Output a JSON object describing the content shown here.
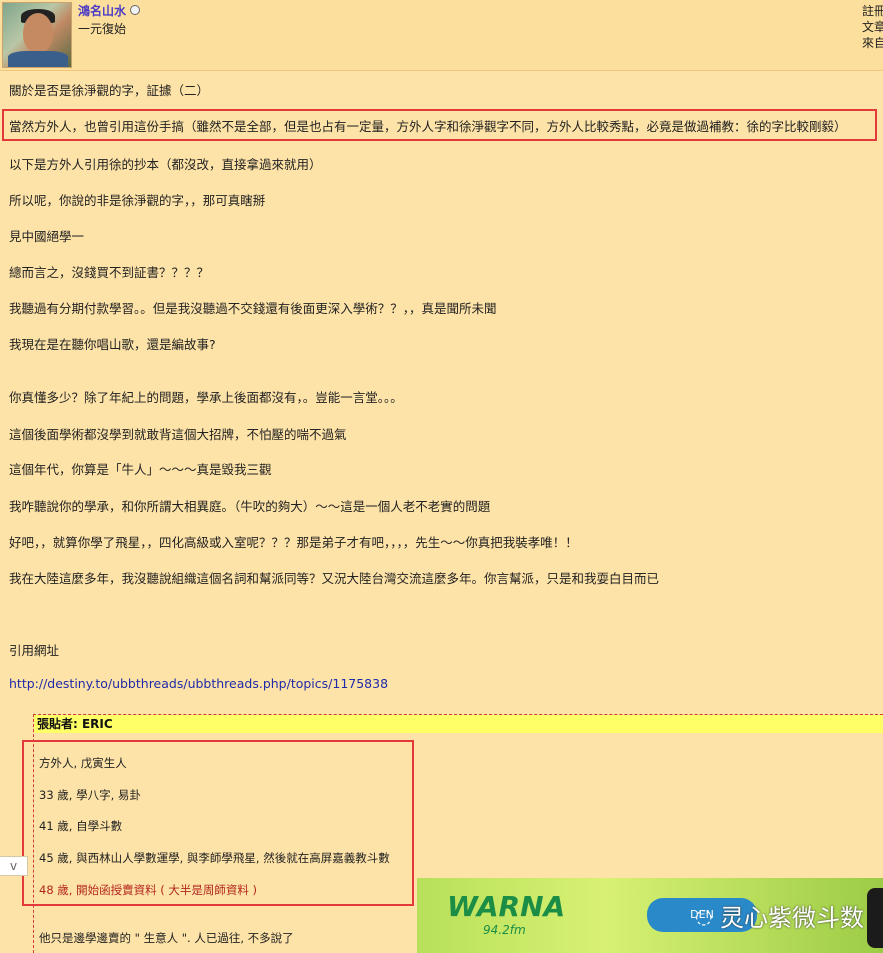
{
  "post": {
    "username": "鴻名山水",
    "user_title": "一元復始",
    "meta": [
      "註冊",
      "文章",
      "來自"
    ],
    "lines": [
      "關於是否是徐淨觀的字，証據（二）",
      "當然方外人，也曾引用這份手搞（雖然不是全部，但是也占有一定量，方外人字和徐淨觀字不同，方外人比較秀點，必竟是做過補教：徐的字比較剛毅）",
      "以下是方外人引用徐的抄本（都沒改，直接拿過來就用）",
      "所以呢，你說的非是徐淨觀的字，，那可真瞎掰",
      "見中國絕學一",
      "總而言之，沒錢買不到証書？？？？",
      "我聽過有分期付款學習。。但是我沒聽過不交錢還有後面更深入學術？？，，真是聞所未聞",
      "我現在是在聽你唱山歌，還是編故事?",
      "你真懂多少？除了年紀上的問題，學承上後面都沒有，。豈能一言堂。。。",
      "這個後面學術都沒學到就敢背這個大招牌，不怕壓的喘不過氣",
      "這個年代，你算是「牛人」～～～真是毀我三觀",
      "我咋聽說你的學承，和你所謂大相異庭。（牛吹的夠大）～～這是一個人老不老實的問題",
      "好吧，，就算你學了飛星，，四化高級或入室呢？？？那是弟子才有吧，，，，先生～～你真把我裝孝唯！！",
      "我在大陸這麼多年，我沒聽說組織這個名詞和幫派同等？又況大陸台灣交流這麼多年。你言幫派，只是和我耍白目而已",
      "引用網址"
    ],
    "link": "http://destiny.to/ubbthreads/ubbthreads.php/topics/1175838"
  },
  "quote": {
    "header": "張貼者: ERIC",
    "lines": [
      "方外人, 戊寅生人",
      "33 歲, 學八字, 易卦",
      "41 歲, 自學斗數",
      "45 歲, 與西林山人學數運學, 與李師學飛星, 然後就在高屏嘉義教斗數",
      "48 歲, 開始函授賣資料 ( 大半是周師資料 )",
      "他只是邊學邊賣的 \" 生意人 \". 人已過往, 不多說了"
    ]
  },
  "toggle": {
    "label": "v"
  },
  "ad": {
    "logo": "WARNA",
    "freq": "94.2fm",
    "pill_text": "DEN",
    "brand": "灵心紫微斗数",
    "icon": "wechat-icon"
  }
}
